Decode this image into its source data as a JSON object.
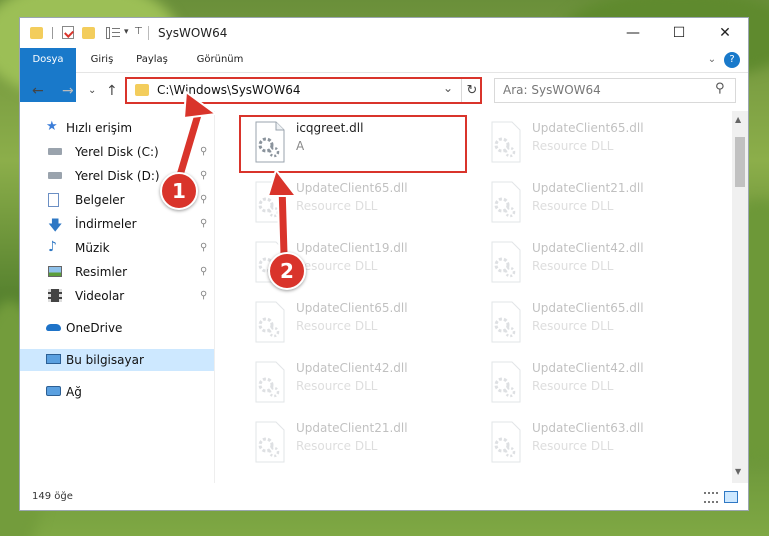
{
  "window": {
    "title": "SysWOW64",
    "buttons": {
      "minimize": "—",
      "maximize": "☐",
      "close": "✕"
    }
  },
  "ribbon": {
    "tabs": [
      "Dosya",
      "Giriş",
      "Paylaş",
      "Görünüm"
    ],
    "expand": "⌄",
    "help": "?"
  },
  "navigation": {
    "back": "←",
    "forward": "→",
    "recent": "⌄",
    "up": "↑",
    "address": "C:\\Windows\\SysWOW64",
    "address_dropdown": "⌄",
    "refresh": "↻",
    "search_placeholder": "Ara: SysWOW64",
    "search_icon": "⚲"
  },
  "sidebar": {
    "items": [
      {
        "label": "Hızlı erişim",
        "icon": "star-icon",
        "pinned": false
      },
      {
        "label": "Yerel Disk (C:)",
        "icon": "drive-icon",
        "pinned": true
      },
      {
        "label": "Yerel Disk (D:)",
        "icon": "drive-icon",
        "pinned": true
      },
      {
        "label": "Belgeler",
        "icon": "documents-icon",
        "pinned": true
      },
      {
        "label": "İndirmeler",
        "icon": "downloads-icon",
        "pinned": true
      },
      {
        "label": "Müzik",
        "icon": "music-icon",
        "pinned": true
      },
      {
        "label": "Resimler",
        "icon": "pictures-icon",
        "pinned": true
      },
      {
        "label": "Videolar",
        "icon": "videos-icon",
        "pinned": true
      },
      {
        "label": "OneDrive",
        "icon": "cloud-icon",
        "pinned": false
      },
      {
        "label": "Bu bilgisayar",
        "icon": "computer-icon",
        "pinned": false
      },
      {
        "label": "Ağ",
        "icon": "network-icon",
        "pinned": false
      }
    ],
    "pin_glyph": "📌"
  },
  "files": [
    {
      "name": "icqgreet.dll",
      "desc": "A",
      "highlight": true
    },
    {
      "name": "UpdateClient65.dll",
      "desc": "Resource DLL"
    },
    {
      "name": "UpdateClient65.dll",
      "desc": "Resource DLL"
    },
    {
      "name": "UpdateClient21.dll",
      "desc": "Resource DLL"
    },
    {
      "name": "UpdateClient19.dll",
      "desc": "Resource DLL"
    },
    {
      "name": "UpdateClient42.dll",
      "desc": "Resource DLL"
    },
    {
      "name": "UpdateClient65.dll",
      "desc": "Resource DLL"
    },
    {
      "name": "UpdateClient65.dll",
      "desc": "Resource DLL"
    },
    {
      "name": "UpdateClient42.dll",
      "desc": "Resource DLL"
    },
    {
      "name": "UpdateClient42.dll",
      "desc": "Resource DLL"
    },
    {
      "name": "UpdateClient21.dll",
      "desc": "Resource DLL"
    },
    {
      "name": "UpdateClient63.dll",
      "desc": "Resource DLL"
    }
  ],
  "status": {
    "count": "149 öğe"
  },
  "annotations": {
    "badge1": "1",
    "badge2": "2",
    "color": "#d9342b"
  }
}
